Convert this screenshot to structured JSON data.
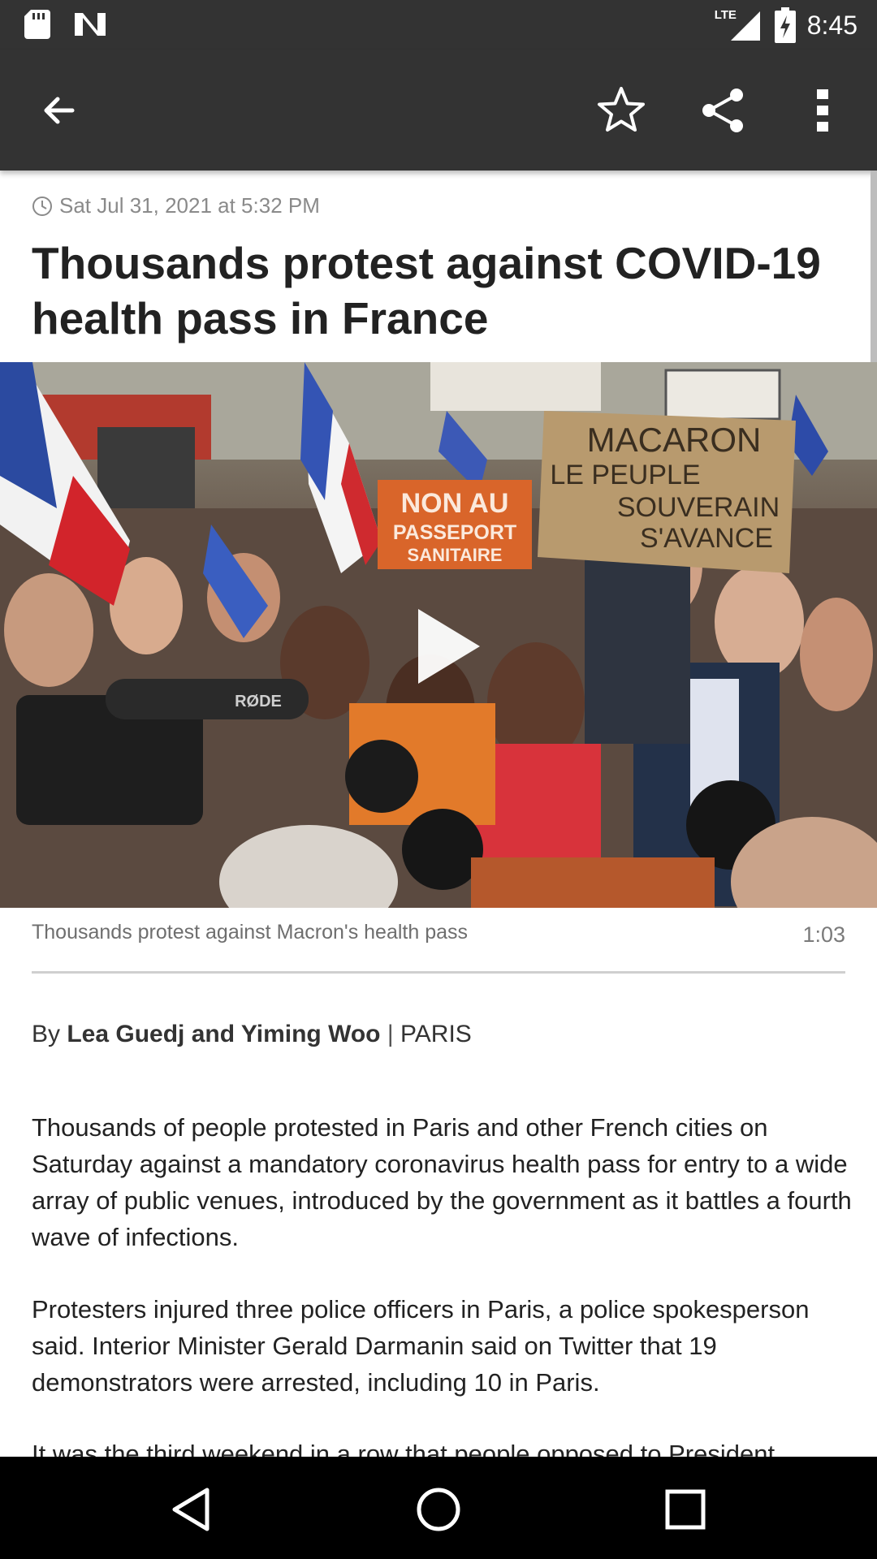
{
  "status_bar": {
    "time": "8:45",
    "network": "LTE"
  },
  "toolbar": {
    "back_icon": "arrow-left-icon",
    "bookmark_icon": "star-outline-icon",
    "share_icon": "share-icon",
    "more_icon": "more-vertical-icon"
  },
  "article": {
    "timestamp": "Sat Jul 31, 2021 at 5:32 PM",
    "headline": "Thousands protest against COVID-19 health pass in France",
    "video": {
      "caption": "Thousands protest against Macron's health pass",
      "duration": "1:03",
      "sign_text_1": "NON AU",
      "sign_text_2": "PASSEPORT",
      "sign_text_3": "SANITAIRE",
      "sign_text_4": "MACARON",
      "sign_text_5": "LE PEUPLE",
      "sign_text_6": "SOUVERAIN",
      "sign_text_7": "S'AVANCE",
      "mic_text": "RØDE"
    },
    "byline": {
      "prefix": "By",
      "authors": "Lea Guedj and Yiming Woo",
      "separator": "|",
      "location": "PARIS"
    },
    "paragraphs": [
      "Thousands of people protested in Paris and other French cities on Saturday against a mandatory coronavirus health pass for entry to a wide array of public venues, introduced by the government as it battles a fourth wave of infections.",
      "Protesters injured three police officers in Paris, a police spokesperson said. Interior Minister Gerald Darmanin said on Twitter that 19 demonstrators were arrested, including 10 in Paris.",
      "It was the third weekend in a row that people opposed to President"
    ]
  },
  "colors": {
    "bar": "#333333",
    "sign_orange": "#d9652a",
    "sign_cardboard": "#b89a6e"
  }
}
